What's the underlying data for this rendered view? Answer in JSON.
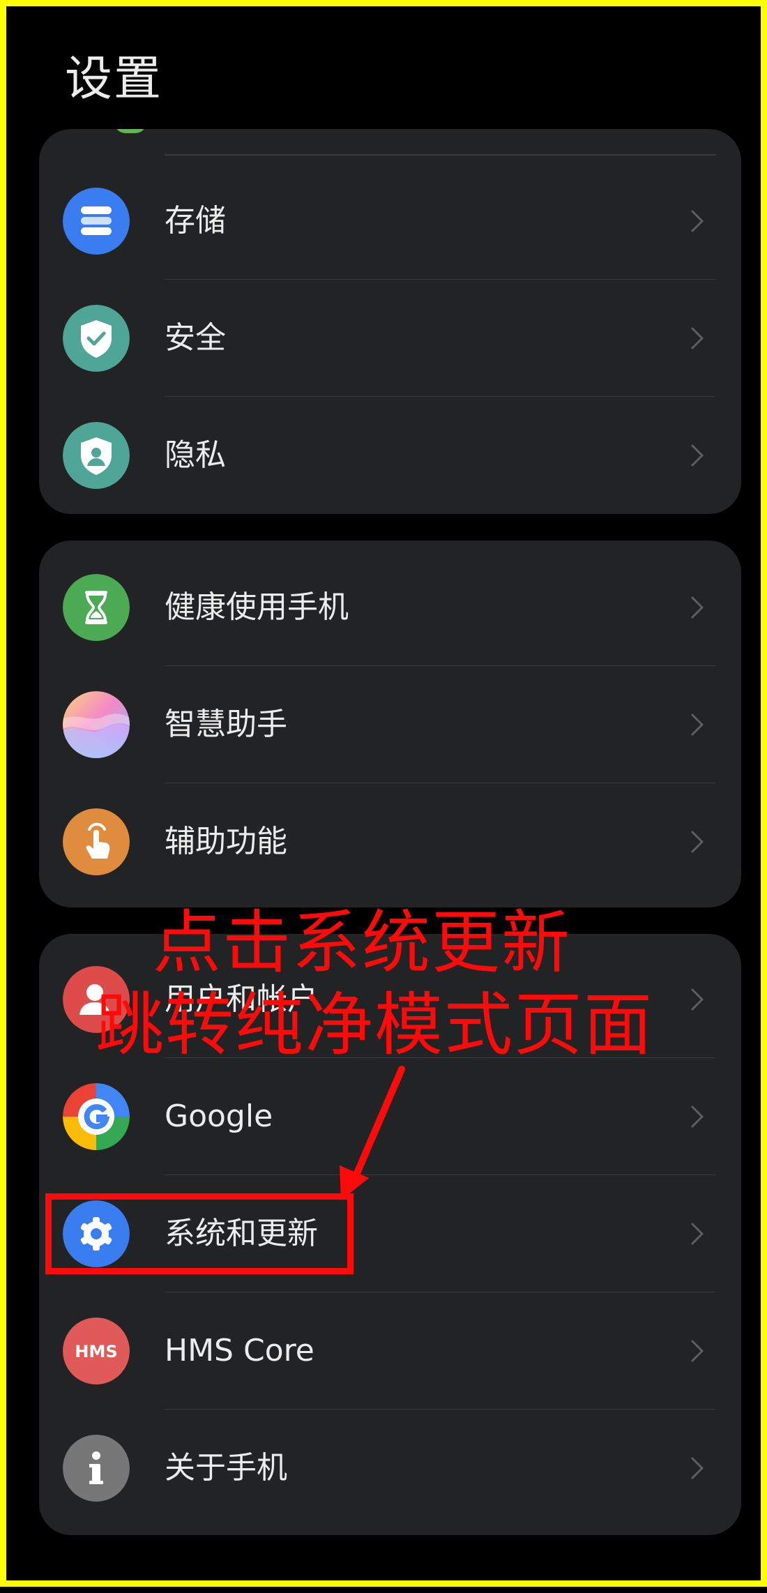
{
  "header": {
    "title": "设置"
  },
  "groups": [
    {
      "items": [
        {
          "label": "存储",
          "icon": "storage-icon",
          "color": "#3a7df0"
        },
        {
          "label": "安全",
          "icon": "shield-check-icon",
          "color": "#4fa596"
        },
        {
          "label": "隐私",
          "icon": "privacy-shield-icon",
          "color": "#4fa596"
        }
      ]
    },
    {
      "items": [
        {
          "label": "健康使用手机",
          "icon": "hourglass-icon",
          "color": "#4caa55"
        },
        {
          "label": "智慧助手",
          "icon": "smart-assistant-icon",
          "color": "#c7a7f5"
        },
        {
          "label": "辅助功能",
          "icon": "hand-touch-icon",
          "color": "#e08c3e"
        }
      ]
    },
    {
      "items": [
        {
          "label": "用户和帐户",
          "icon": "user-icon",
          "color": "#dd4b4b"
        },
        {
          "label": "Google",
          "icon": "google-icon",
          "color": "#ffffff"
        },
        {
          "label": "系统和更新",
          "icon": "gear-icon",
          "color": "#3a7df0"
        },
        {
          "label": "HMS Core",
          "icon": "hms-icon",
          "color": "#e05a5a",
          "icon_text": "HMS"
        },
        {
          "label": "关于手机",
          "icon": "info-icon",
          "color": "#777777"
        }
      ]
    }
  ],
  "annotation": {
    "line1": "点击系统更新",
    "line2": "跳转纯净模式页面",
    "color": "#ff0a0a"
  }
}
